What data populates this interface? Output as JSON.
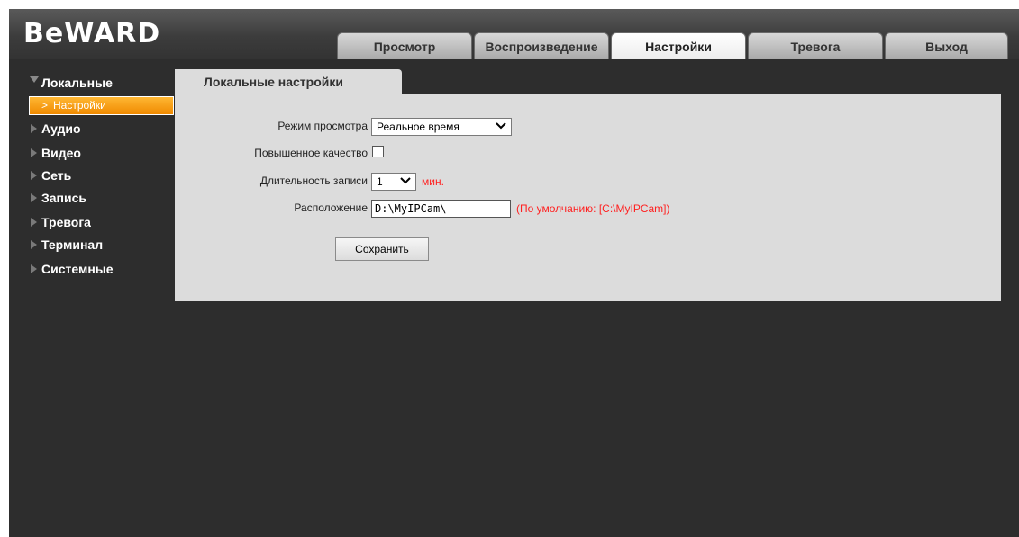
{
  "app": {
    "logo": "BeWARD"
  },
  "tabs": [
    {
      "label": "Просмотр"
    },
    {
      "label": "Воспроизведение"
    },
    {
      "label": "Настройки",
      "active": true
    },
    {
      "label": "Тревога"
    },
    {
      "label": "Выход"
    }
  ],
  "sidebar": {
    "expanded": {
      "label": "Локальные",
      "sub_label": "Настройки",
      "sub_arrow": ">"
    },
    "items": [
      {
        "label": "Аудио"
      },
      {
        "label": "Видео"
      },
      {
        "label": "Сеть"
      },
      {
        "label": "Запись"
      },
      {
        "label": "Тревога"
      },
      {
        "label": "Терминал"
      },
      {
        "label": "Системные"
      }
    ]
  },
  "content": {
    "tab_title": "Локальные настройки",
    "view_mode": {
      "label": "Режим просмотра",
      "value": "Реальное время"
    },
    "high_quality": {
      "label": "Повышенное качество",
      "checked": false
    },
    "record_duration": {
      "label": "Длительность записи",
      "value": "1",
      "unit": "мин."
    },
    "location": {
      "label": "Расположение",
      "value": "D:\\MyIPCam\\",
      "default_note": "(По умолчанию: [C:\\MyIPCam])"
    },
    "save_label": "Сохранить"
  },
  "colors": {
    "accent": "#f59a10",
    "warning": "#ff2020",
    "panel": "#dcdcdc",
    "background": "#2d2d2d"
  }
}
